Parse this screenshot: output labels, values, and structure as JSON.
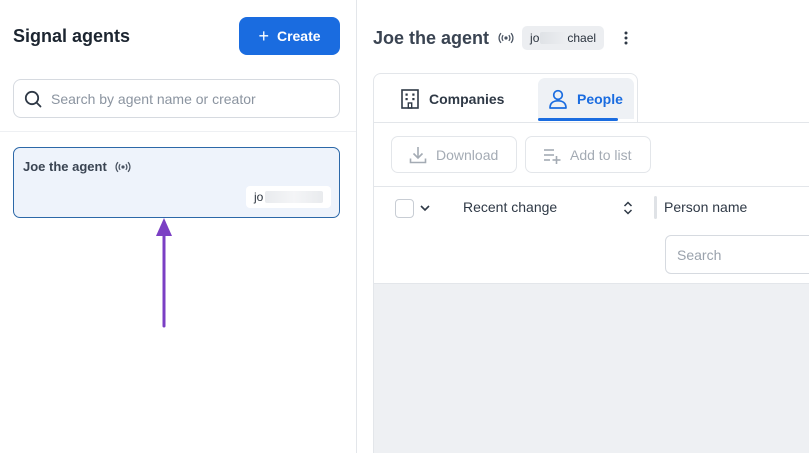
{
  "left_panel": {
    "title": "Signal agents",
    "create_label": "Create",
    "search_placeholder": "Search by agent name or creator",
    "agents": [
      {
        "name": "Joe the agent",
        "owner_visible": "jo"
      }
    ]
  },
  "right_panel": {
    "agent_name": "Joe the agent",
    "owner_prefix": "jo",
    "owner_suffix": "chael",
    "tabs": [
      {
        "label": "Companies",
        "icon": "building-icon",
        "active": false
      },
      {
        "label": "People",
        "icon": "person-icon",
        "active": true
      }
    ],
    "toolbar": {
      "download_label": "Download",
      "add_to_list_label": "Add to list"
    },
    "table": {
      "columns": [
        "Recent change",
        "Person name"
      ],
      "column_search_placeholder": "Search"
    }
  },
  "colors": {
    "accent": "#1a6ce0",
    "card_selected_bg": "#eef3fb",
    "card_selected_border": "#2c68a8",
    "annotation_arrow": "#7b3fc4"
  }
}
